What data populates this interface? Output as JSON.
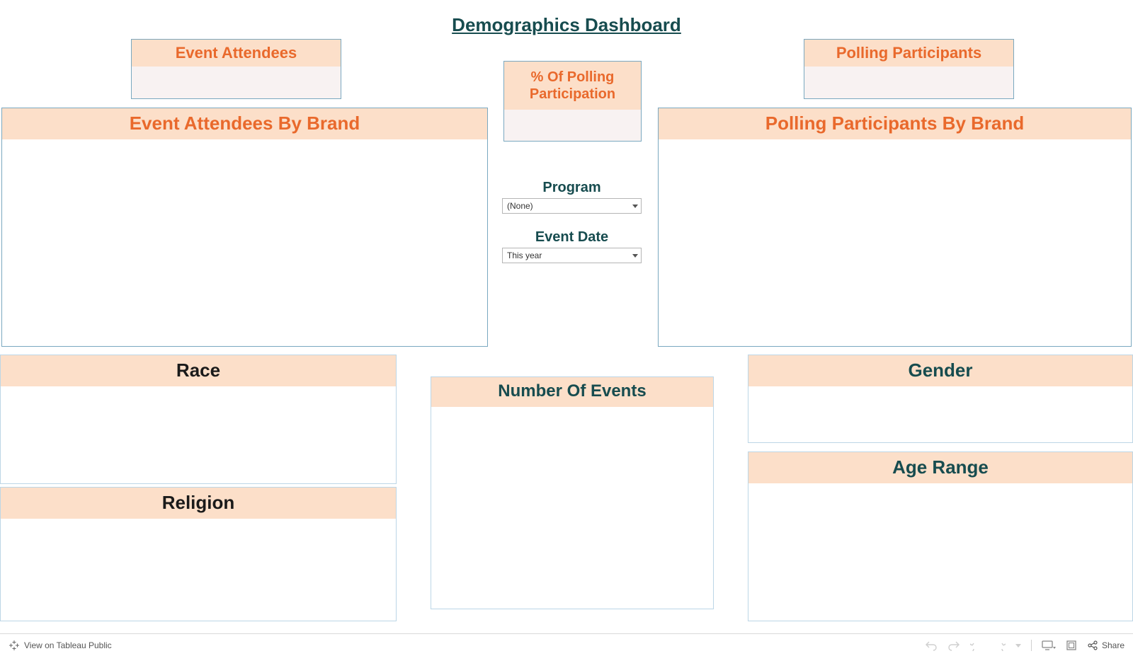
{
  "title": "Demographics Dashboard",
  "panels": {
    "event_attendees": {
      "label": "Event Attendees"
    },
    "polling_participants": {
      "label": "Polling Participants"
    },
    "polling_pct": {
      "label": "% Of Polling Participation"
    },
    "attendees_by_brand": {
      "label": "Event Attendees By Brand"
    },
    "polling_by_brand": {
      "label": "Polling Participants By Brand"
    },
    "race": {
      "label": "Race"
    },
    "religion": {
      "label": "Religion"
    },
    "number_of_events": {
      "label": "Number Of Events"
    },
    "gender": {
      "label": "Gender"
    },
    "age_range": {
      "label": "Age Range"
    }
  },
  "filters": {
    "program": {
      "label": "Program",
      "value": "(None)"
    },
    "event_date": {
      "label": "Event Date",
      "value": "This year"
    }
  },
  "footer": {
    "view_link": "View on Tableau Public",
    "share": "Share"
  }
}
